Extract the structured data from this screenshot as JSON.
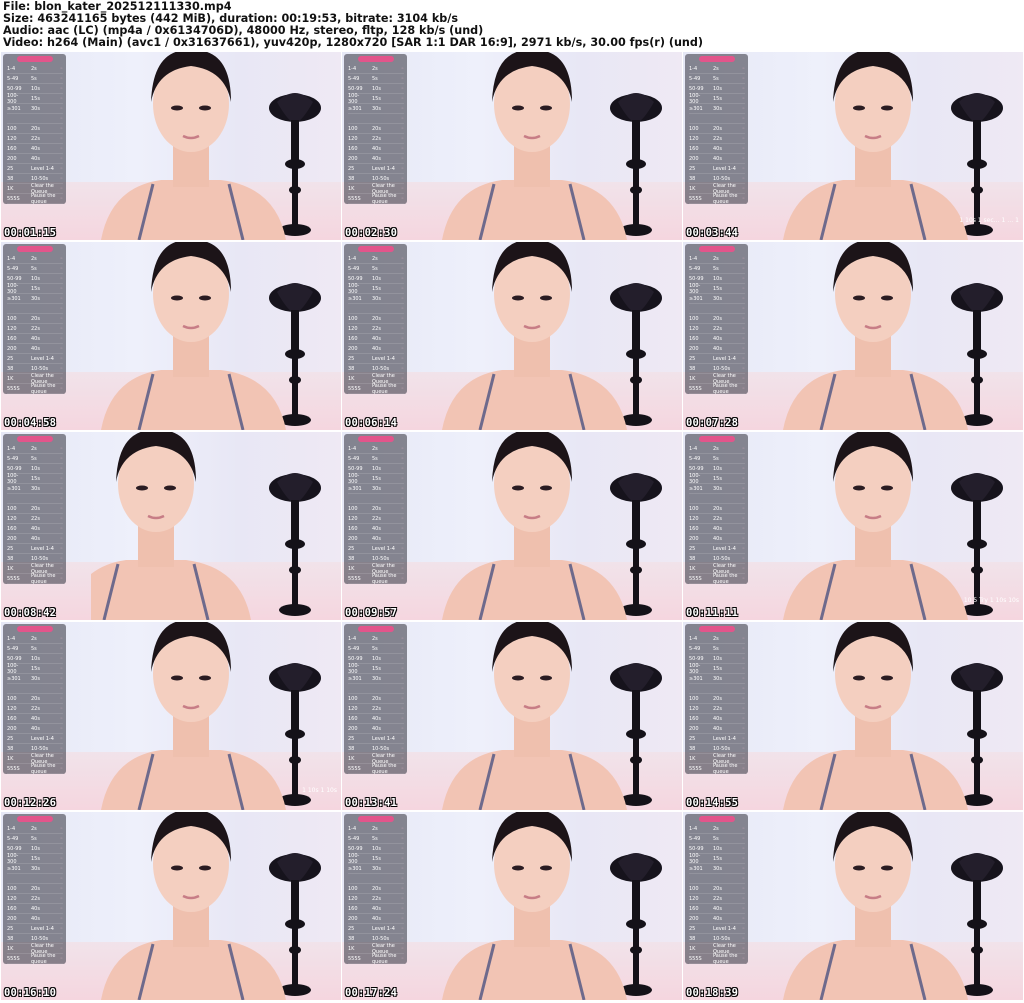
{
  "header": {
    "file": "File: blon_kater_202512111330.mp4",
    "size": "Size: 463241165 bytes (442 MiB), duration: 00:19:53, bitrate: 3104 kb/s",
    "audio": "Audio: aac (LC) (mp4a / 0x6134706D), 48000 Hz, stereo, fltp, 128 kb/s (und)",
    "video": "Video: h264 (Main) (avc1 / 0x31637661), yuv420p, 1280x720 [SAR 1:1 DAR 16:9], 2971 kb/s, 30.00 fps(r) (und)"
  },
  "panel_rows": [
    {
      "a": "1-4",
      "b": "2s"
    },
    {
      "a": "5-49",
      "b": "5s"
    },
    {
      "a": "50-99",
      "b": "10s"
    },
    {
      "a": "100-300",
      "b": "15s"
    },
    {
      "a": "≥301",
      "b": "30s"
    },
    {
      "a": "",
      "b": ""
    },
    {
      "a": "100",
      "b": "20s"
    },
    {
      "a": "120",
      "b": "22s"
    },
    {
      "a": "160",
      "b": "40s"
    },
    {
      "a": "200",
      "b": "40s"
    },
    {
      "a": "25",
      "b": "Level 1-4"
    },
    {
      "a": "38",
      "b": "10-50s"
    },
    {
      "a": "1K",
      "b": "Clear the Queue"
    },
    {
      "a": "555S",
      "b": "Pause the queue"
    }
  ],
  "thumbnails": [
    {
      "time": "00:01:15",
      "gift": ""
    },
    {
      "time": "00:02:30",
      "gift": ""
    },
    {
      "time": "00:03:44",
      "gift": "1 10s 1 sec… 1 … 1"
    },
    {
      "time": "00:04:58",
      "gift": ""
    },
    {
      "time": "00:06:14",
      "gift": ""
    },
    {
      "time": "00:07:28",
      "gift": ""
    },
    {
      "time": "00:08:42",
      "gift": ""
    },
    {
      "time": "00:09:57",
      "gift": ""
    },
    {
      "time": "00:11:11",
      "gift": "10 5 Try 1 10s 10s"
    },
    {
      "time": "00:12:26",
      "gift": "1 10s 1 10s"
    },
    {
      "time": "00:13:41",
      "gift": ""
    },
    {
      "time": "00:14:55",
      "gift": ""
    },
    {
      "time": "00:16:10",
      "gift": ""
    },
    {
      "time": "00:17:24",
      "gift": ""
    },
    {
      "time": "00:18:39",
      "gift": ""
    }
  ]
}
